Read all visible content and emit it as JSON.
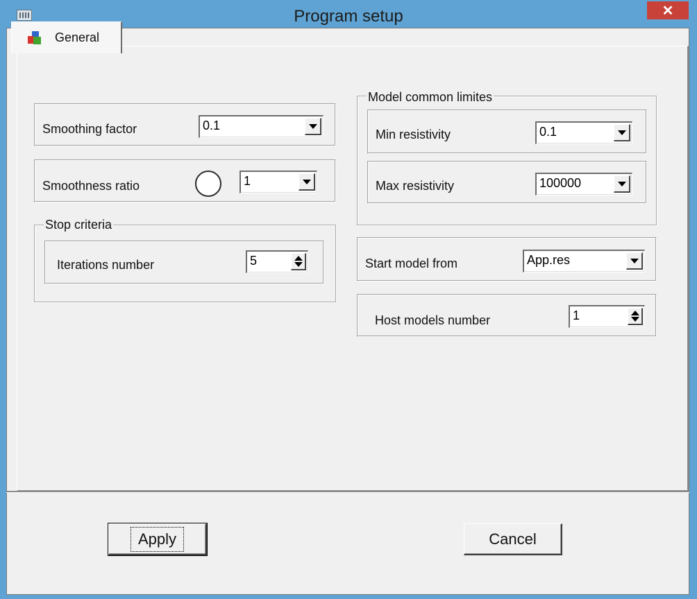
{
  "window": {
    "title": "Program setup",
    "close_label": "✕"
  },
  "tabs": [
    {
      "label": "General",
      "selected": true
    }
  ],
  "general": {
    "smoothing_factor": {
      "label": "Smoothing factor",
      "value": "0.1"
    },
    "smoothness_ratio": {
      "label": "Smoothness ratio",
      "value": "1"
    },
    "stop_criteria": {
      "legend": "Stop criteria",
      "iterations_number": {
        "label": "Iterations number",
        "value": "5"
      }
    },
    "model_limits": {
      "legend": "Model common limites",
      "min_resistivity": {
        "label": "Min resistivity",
        "value": "0.1"
      },
      "max_resistivity": {
        "label": "Max resistivity",
        "value": "100000"
      }
    },
    "start_model_from": {
      "label": "Start model from",
      "value": "App.res"
    },
    "host_models_number": {
      "label": "Host models number",
      "value": "1"
    }
  },
  "buttons": {
    "apply": "Apply",
    "cancel": "Cancel"
  },
  "colors": {
    "titlebar": "#5ea3d3",
    "close_button": "#c9423a",
    "dialog_bg": "#f0f0f0"
  }
}
